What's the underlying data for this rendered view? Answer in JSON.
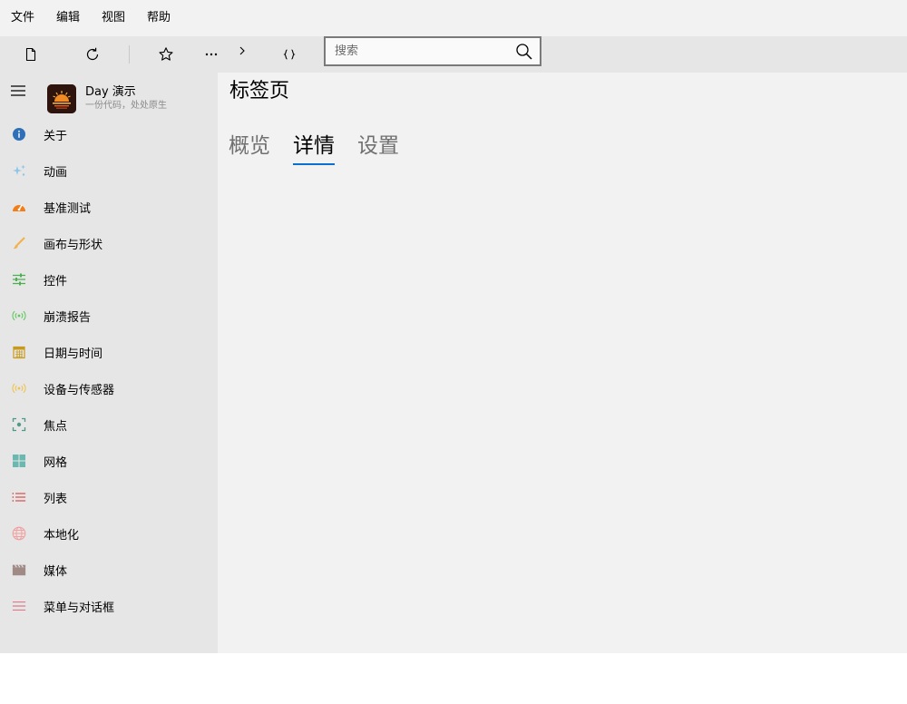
{
  "menu": [
    {
      "label": "文件"
    },
    {
      "label": "编辑"
    },
    {
      "label": "视图"
    },
    {
      "label": "帮助"
    }
  ],
  "toolbar": {
    "buttons": [
      {
        "icon": "page-icon"
      },
      {
        "icon": "refresh-icon"
      },
      {
        "icon": "star-icon"
      },
      {
        "icon": "more-icon"
      },
      {
        "icon": "chevron-right-icon"
      },
      {
        "icon": "braces-icon"
      }
    ],
    "search": {
      "placeholder": "搜索",
      "value": "",
      "icon": "search-icon"
    }
  },
  "sidebar": {
    "app_name": "Day 演示",
    "app_tagline": "一份代码，处处原生",
    "items": [
      {
        "label": "关于",
        "icon": "info-icon",
        "color": "#2f6fb7"
      },
      {
        "label": "动画",
        "icon": "sparkle-icon",
        "color": "#8ec5e8"
      },
      {
        "label": "基准测试",
        "icon": "speedometer-icon",
        "color": "#f07f1a"
      },
      {
        "label": "画布与形状",
        "icon": "brush-icon",
        "color": "#f2b14a"
      },
      {
        "label": "控件",
        "icon": "sliders-icon",
        "color": "#4caf50"
      },
      {
        "label": "崩溃报告",
        "icon": "broadcast-icon",
        "color": "#5cc85c"
      },
      {
        "label": "日期与时间",
        "icon": "calendar-icon",
        "color": "#c79a1b"
      },
      {
        "label": "设备与传感器",
        "icon": "sensor-icon",
        "color": "#f0c24a"
      },
      {
        "label": "焦点",
        "icon": "focus-icon",
        "color": "#4e9a8a"
      },
      {
        "label": "网格",
        "icon": "grid-icon",
        "color": "#6bb8b0"
      },
      {
        "label": "列表",
        "icon": "list-icon",
        "color": "#d9534f"
      },
      {
        "label": "本地化",
        "icon": "globe-icon",
        "color": "#f2a0a0"
      },
      {
        "label": "媒体",
        "icon": "clapper-icon",
        "color": "#a08a86"
      },
      {
        "label": "菜单与对话框",
        "icon": "menu-lines-icon",
        "color": "#e07a8a"
      }
    ]
  },
  "content": {
    "title": "标签页",
    "tabs": [
      {
        "label": "概览",
        "selected": false
      },
      {
        "label": "详情",
        "selected": true
      },
      {
        "label": "设置",
        "selected": false
      }
    ],
    "accent": "#0a6fd1"
  }
}
